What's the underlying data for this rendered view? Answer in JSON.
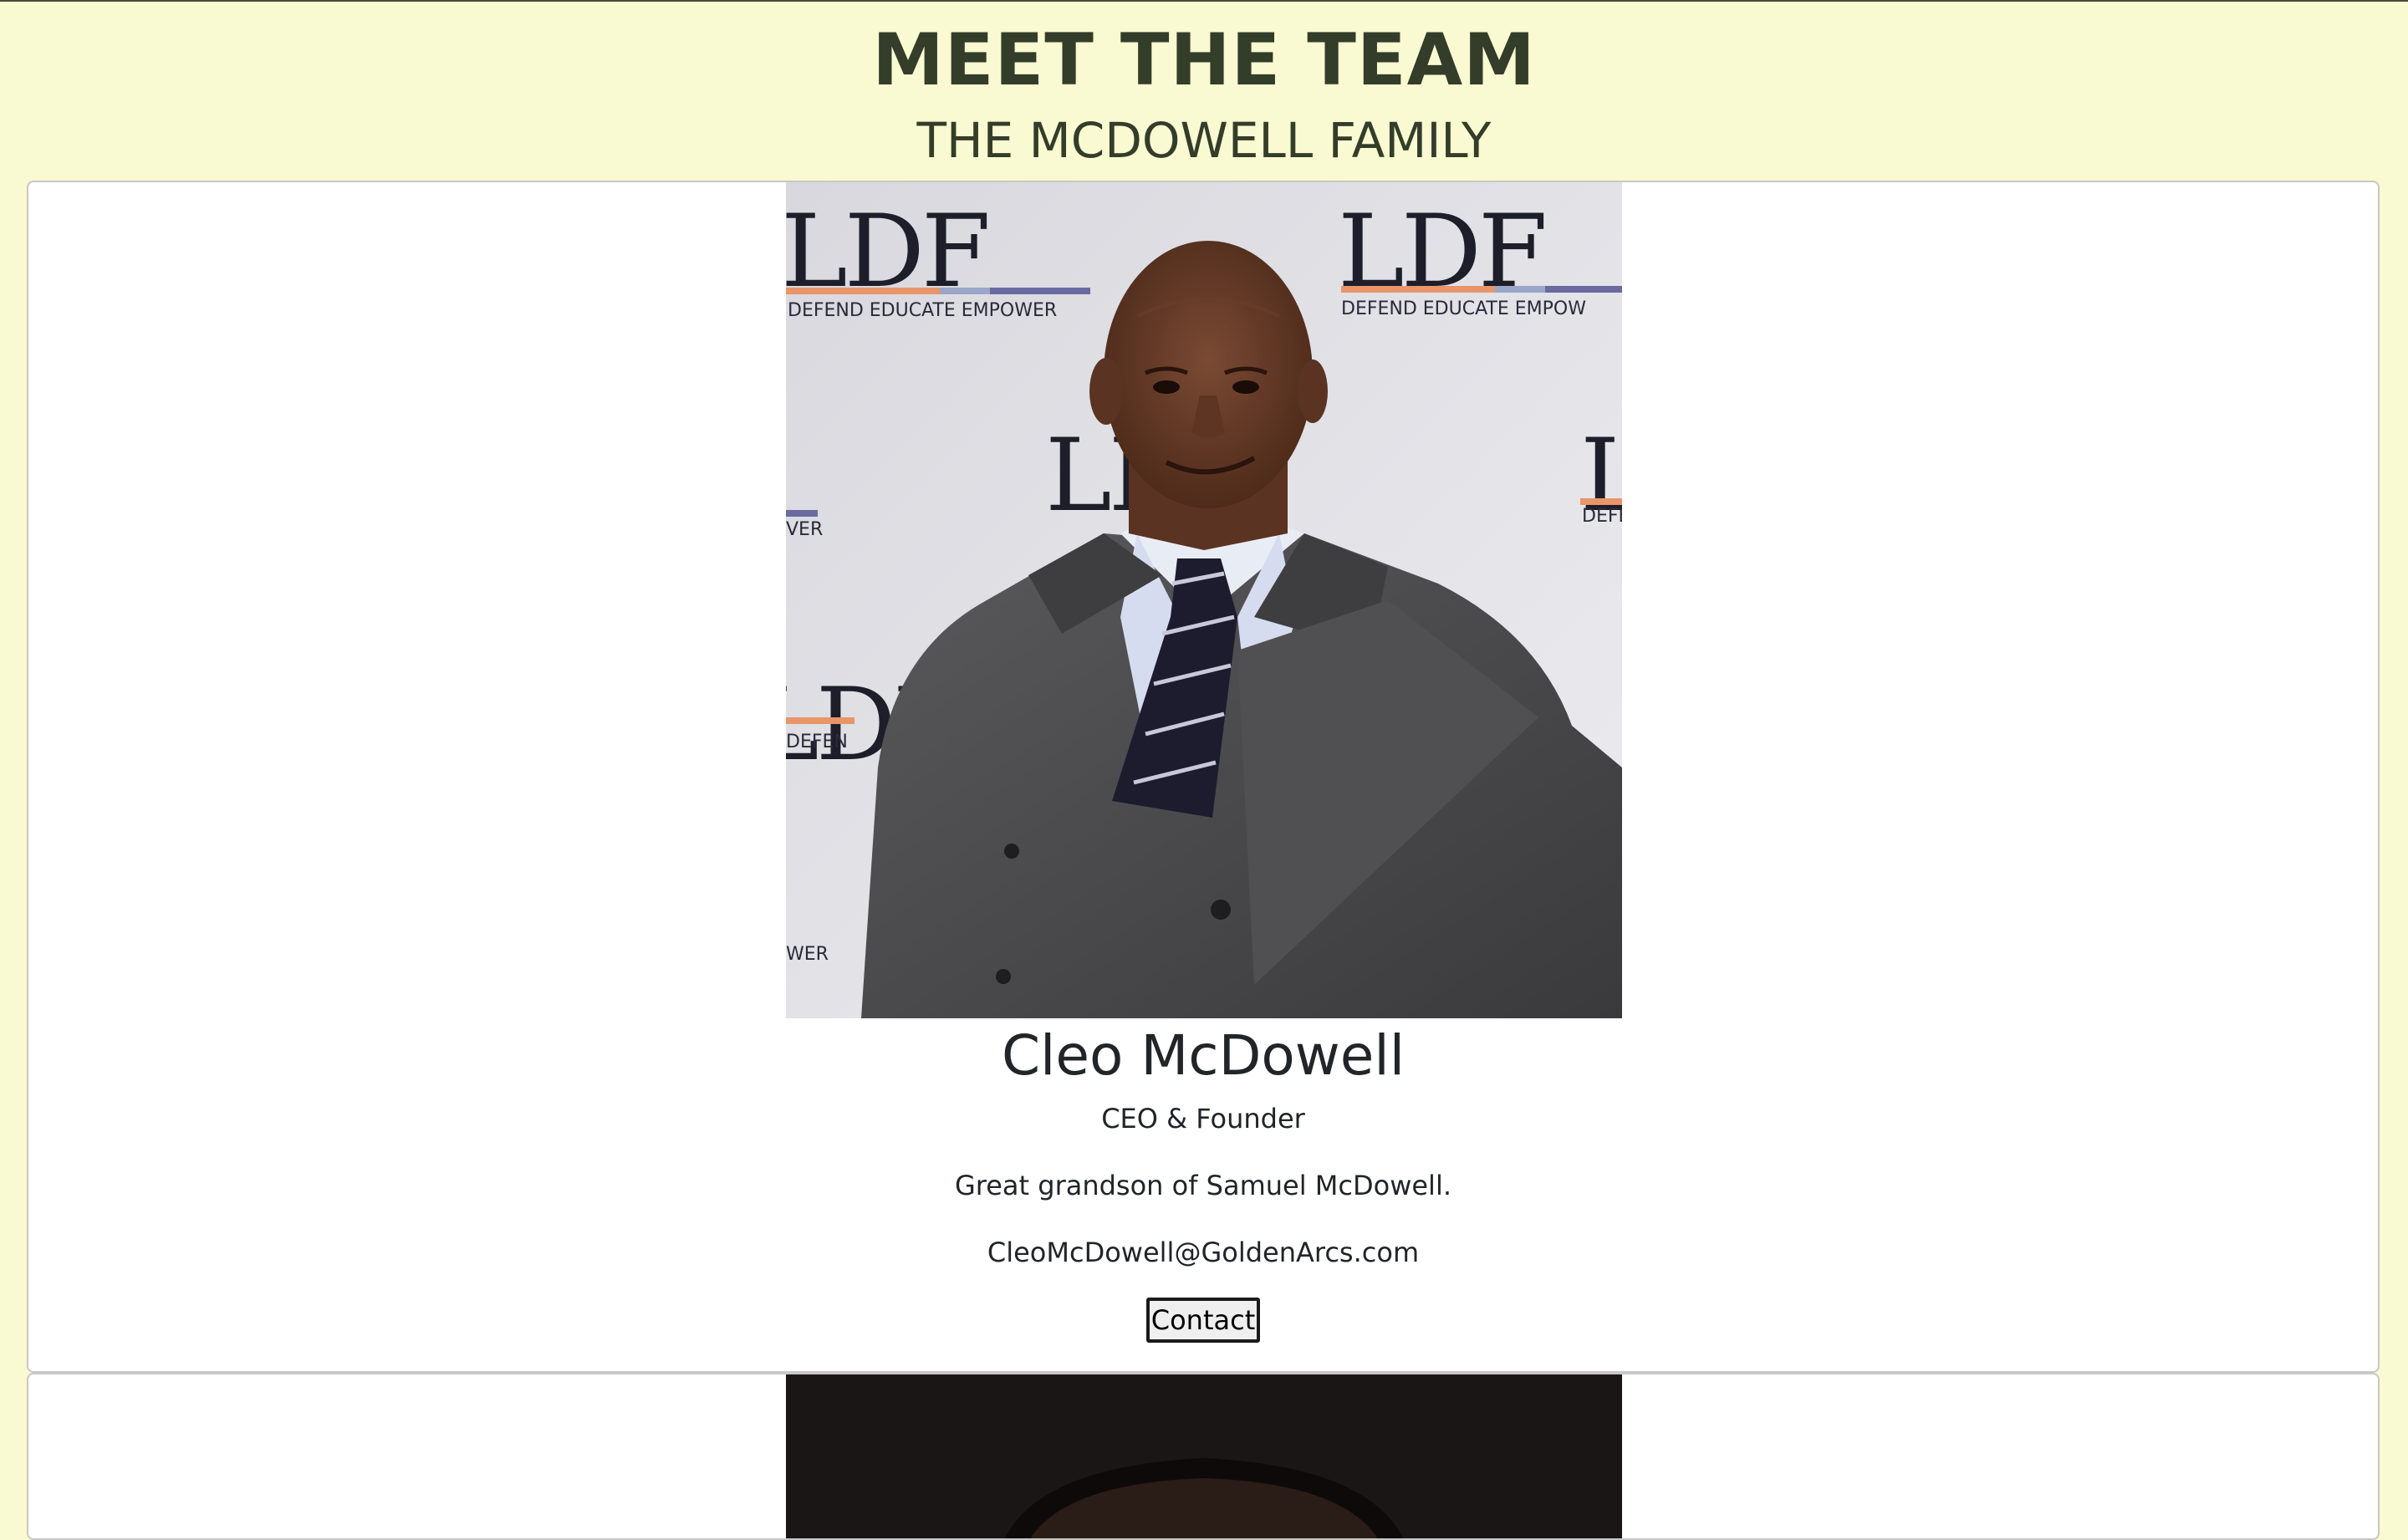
{
  "header": {
    "title": "MEET THE TEAM",
    "subtitle": "THE MCDOWELL FAMILY"
  },
  "members": [
    {
      "name": "Cleo McDowell",
      "role": "CEO & Founder",
      "bio": "Great grandson of Samuel McDowell.",
      "email": "CleoMcDowell@GoldenArcs.com",
      "contact_label": "Contact",
      "photo": {
        "backdrop_text": "LDF",
        "backdrop_tagline": "DEFEND  EDUCATE  EMPOWER"
      }
    }
  ],
  "colors": {
    "page_background": "#fafad2",
    "heading": "#333d29",
    "card_background": "#ffffff",
    "card_border": "#c8c8c8"
  }
}
